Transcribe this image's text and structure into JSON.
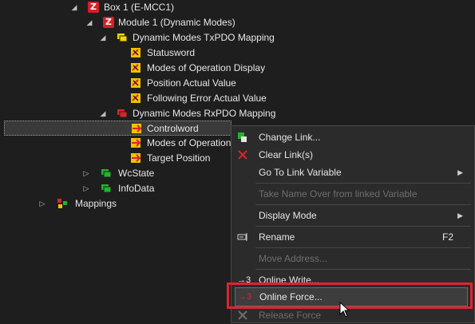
{
  "tree": {
    "box": "Box 1 (E-MCC1)",
    "module": "Module 1 (Dynamic Modes)",
    "tx_mapping": "Dynamic Modes TxPDO Mapping",
    "tx_items": [
      "Statusword",
      "Modes of Operation Display",
      "Position Actual Value",
      "Following Error Actual Value"
    ],
    "rx_mapping": "Dynamic Modes RxPDO Mapping",
    "rx_items": [
      "Controlword",
      "Modes of Operation",
      "Target Position"
    ],
    "wcstate": "WcState",
    "infodata": "InfoData",
    "mappings": "Mappings",
    "box_icon_letter": "Z"
  },
  "menu": {
    "change_link": "Change Link...",
    "clear_links": "Clear Link(s)",
    "go_to_link": "Go To Link Variable",
    "take_name": "Take Name Over from linked Variable",
    "display_mode": "Display Mode",
    "rename": "Rename",
    "rename_shortcut": "F2",
    "move_address": "Move Address...",
    "online_write": "Online Write...",
    "online_force": "Online Force...",
    "release_force": "Release Force",
    "online_write_icon_text": "→3",
    "online_force_icon_text": "→3"
  },
  "colors": {
    "highlight_frame": "#e0242c",
    "box_icon": "#d51f26",
    "tx_folder": "#f2d600",
    "rx_folder": "#d9262a",
    "green": "#22b22e"
  },
  "side_marker": "3"
}
